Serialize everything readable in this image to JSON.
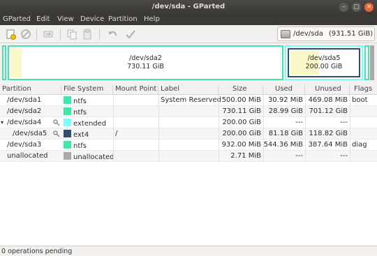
{
  "window": {
    "title": "/dev/sda - GParted",
    "buttons": [
      "–",
      "▢",
      "×"
    ]
  },
  "menu": [
    "GParted",
    "Edit",
    "View",
    "Device",
    "Partition",
    "Help"
  ],
  "toolbar": {
    "icons": [
      "new-icon",
      "delete-icon",
      "resize-move-icon",
      "copy-icon",
      "paste-icon",
      "undo-icon",
      "apply-icon"
    ]
  },
  "device": {
    "name": "/dev/sda",
    "size": "(931.51 GiB)"
  },
  "map": {
    "sda2": {
      "name": "/dev/sda2",
      "size": "730.11 GiB"
    },
    "sda5": {
      "name": "/dev/sda5",
      "size": "200.00 GiB"
    }
  },
  "table": {
    "columns": [
      "Partition",
      "File System",
      "Mount Point",
      "Label",
      "Size",
      "Used",
      "Unused",
      "Flags"
    ],
    "rows": [
      {
        "partition": "/dev/sda1",
        "fs": "ntfs",
        "fs_color": "#42e5ac",
        "mount": "",
        "label": "System Reserved",
        "size": "500.00 MiB",
        "used": "30.92 MiB",
        "unused": "469.08 MiB",
        "flags": "boot"
      },
      {
        "partition": "/dev/sda2",
        "fs": "ntfs",
        "fs_color": "#42e5ac",
        "mount": "",
        "label": "",
        "size": "730.11 GiB",
        "used": "28.99 GiB",
        "unused": "701.12 GiB",
        "flags": ""
      },
      {
        "partition": "/dev/sda4",
        "fs": "extended",
        "fs_color": "#7dfcfe",
        "mount": "",
        "label": "",
        "size": "200.00 GiB",
        "used": "---",
        "unused": "---",
        "flags": ""
      },
      {
        "partition": "/dev/sda5",
        "fs": "ext4",
        "fs_color": "#314e6c",
        "mount": "/",
        "label": "",
        "size": "200.00 GiB",
        "used": "81.18 GiB",
        "unused": "118.82 GiB",
        "flags": ""
      },
      {
        "partition": "/dev/sda3",
        "fs": "ntfs",
        "fs_color": "#42e5ac",
        "mount": "",
        "label": "",
        "size": "932.00 MiB",
        "used": "544.36 MiB",
        "unused": "387.64 MiB",
        "flags": "diag"
      },
      {
        "partition": "unallocated",
        "fs": "unallocated",
        "fs_color": "#a9a9a9",
        "mount": "",
        "label": "",
        "size": "2.71 MiB",
        "used": "---",
        "unused": "---",
        "flags": ""
      }
    ]
  },
  "status": "0 operations pending"
}
